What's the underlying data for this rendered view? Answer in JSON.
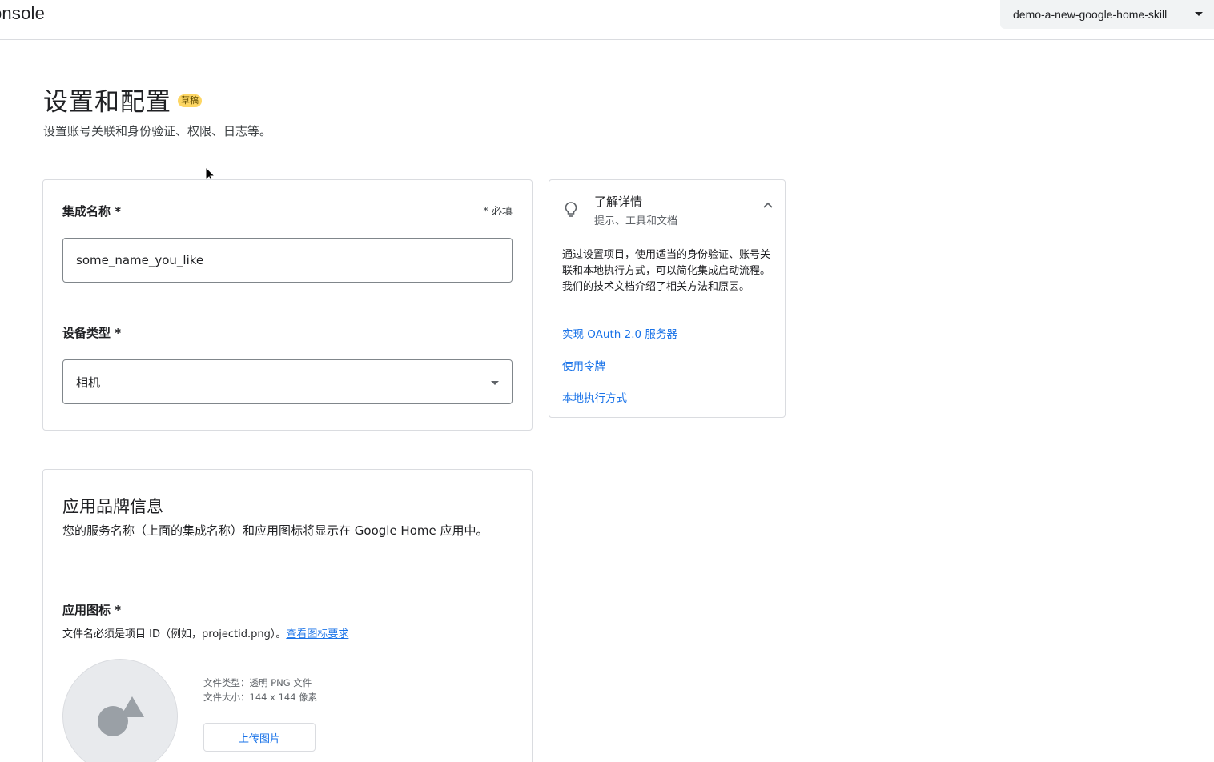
{
  "header": {
    "app_title": "onsole",
    "project_name": "demo-a-new-google-home-skill"
  },
  "page": {
    "title": "设置和配置",
    "badge": "草稿",
    "subtitle": "设置账号关联和身份验证、权限、日志等。"
  },
  "main_card": {
    "required_note": "* 必填",
    "integration_name_label": "集成名称 *",
    "integration_name_value": "some_name_you_like",
    "device_type_label": "设备类型 *",
    "device_type_value": "相机"
  },
  "learn_card": {
    "title": "了解详情",
    "subtitle": "提示、工具和文档",
    "body": "通过设置项目，使用适当的身份验证、账号关联和本地执行方式，可以简化集成启动流程。我们的技术文档介绍了相关方法和原因。",
    "links": [
      "实现 OAuth 2.0 服务器",
      "使用令牌",
      "本地执行方式"
    ]
  },
  "brand_card": {
    "title": "应用品牌信息",
    "description": "您的服务名称（上面的集成名称）和应用图标将显示在 Google Home 应用中。",
    "icon_label": "应用图标 *",
    "icon_hint": "文件名必须是项目 ID（例如，projectid.png）。",
    "icon_hint_link": "查看图标要求",
    "file_type": "文件类型：透明 PNG 文件",
    "file_size": "文件大小：144 x 144 像素",
    "upload_label": "上传图片"
  },
  "colors": {
    "accent": "#1a73e8",
    "badge": "#fdd663",
    "border": "#dadce0"
  }
}
